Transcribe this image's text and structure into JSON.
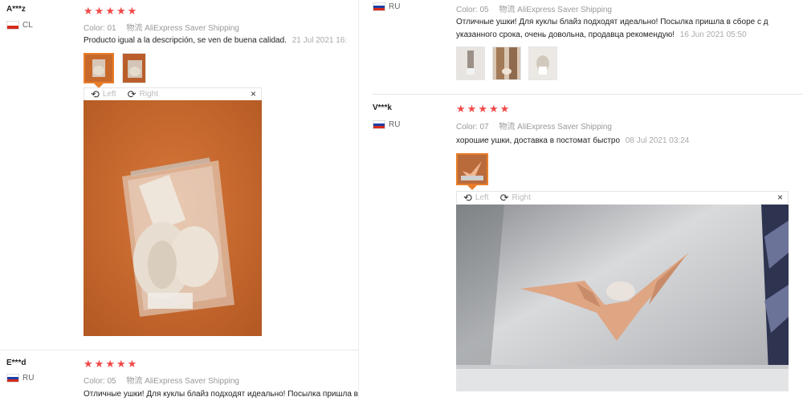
{
  "reviews_left": [
    {
      "user": "A***z",
      "country": "CL",
      "stars": 5,
      "color_label": "Color:",
      "color_value": "01",
      "shipping_prefix": "物流",
      "shipping": "AliExpress Saver Shipping",
      "text": "Producto igual a la descripción, se ven de buena calidad.",
      "date": "21 Jul 2021 16:",
      "viewer": {
        "left": "Left",
        "right": "Right",
        "close": "×"
      }
    },
    {
      "user": "E***d",
      "country": "RU",
      "stars": 5,
      "color_label": "Color:",
      "color_value": "05",
      "shipping_prefix": "物流",
      "shipping": "AliExpress Saver Shipping",
      "text": "Отличные ушки! Для куклы блайз подходят идеально! Посылка пришла в сборе с другими товарами ранее"
    }
  ],
  "reviews_right": [
    {
      "country": "RU",
      "color_label": "Color:",
      "color_value": "05",
      "shipping_prefix": "物流",
      "shipping": "AliExpress Saver Shipping",
      "text_line1": "Отличные ушки! Для куклы блайз подходят идеально! Посылка пришла в сборе с д",
      "text_line2": "указанного срока, очень довольна, продавца рекомендую!",
      "date": "16 Jun 2021 05:50"
    },
    {
      "user": "V***k",
      "country": "RU",
      "stars": 5,
      "color_label": "Color:",
      "color_value": "07",
      "shipping_prefix": "物流",
      "shipping": "AliExpress Saver Shipping",
      "text": "хорошие ушки, доставка в постомат быстро",
      "date": "08 Jul 2021 03:24",
      "viewer": {
        "left": "Left",
        "right": "Right",
        "close": "×"
      }
    }
  ],
  "colors": {
    "star": "#f04a4a",
    "active_thumb": "#e87e2a"
  }
}
